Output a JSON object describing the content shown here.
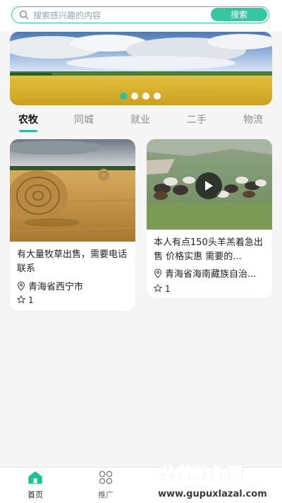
{
  "search": {
    "placeholder": "搜索感兴趣的内容",
    "button_label": "搜索"
  },
  "banner": {
    "slide_count": 4,
    "active_index": 0
  },
  "tabs": [
    {
      "label": "农牧",
      "active": true
    },
    {
      "label": "同城",
      "active": false
    },
    {
      "label": "就业",
      "active": false
    },
    {
      "label": "二手",
      "active": false
    },
    {
      "label": "物流",
      "active": false
    }
  ],
  "cards": [
    {
      "title": "有大量牧草出售，需要电话联系",
      "location": "青海省西宁市",
      "favorites": "1",
      "media": "photo"
    },
    {
      "title": "本人有点150头羊羔着急出售 价格实惠 需要的...",
      "location": "青海省海南藏族自治...",
      "favorites": "1",
      "media": "video"
    }
  ],
  "bottom_nav": [
    {
      "label": "首页",
      "icon": "home-icon",
      "active": true
    },
    {
      "label": "推广",
      "icon": "grid-icon",
      "active": false
    }
  ],
  "watermark": {
    "title": "谷普软件园",
    "url": "www.gupuxlazal.com"
  },
  "colors": {
    "accent": "#22c09a",
    "search_border": "#36c6a2"
  }
}
